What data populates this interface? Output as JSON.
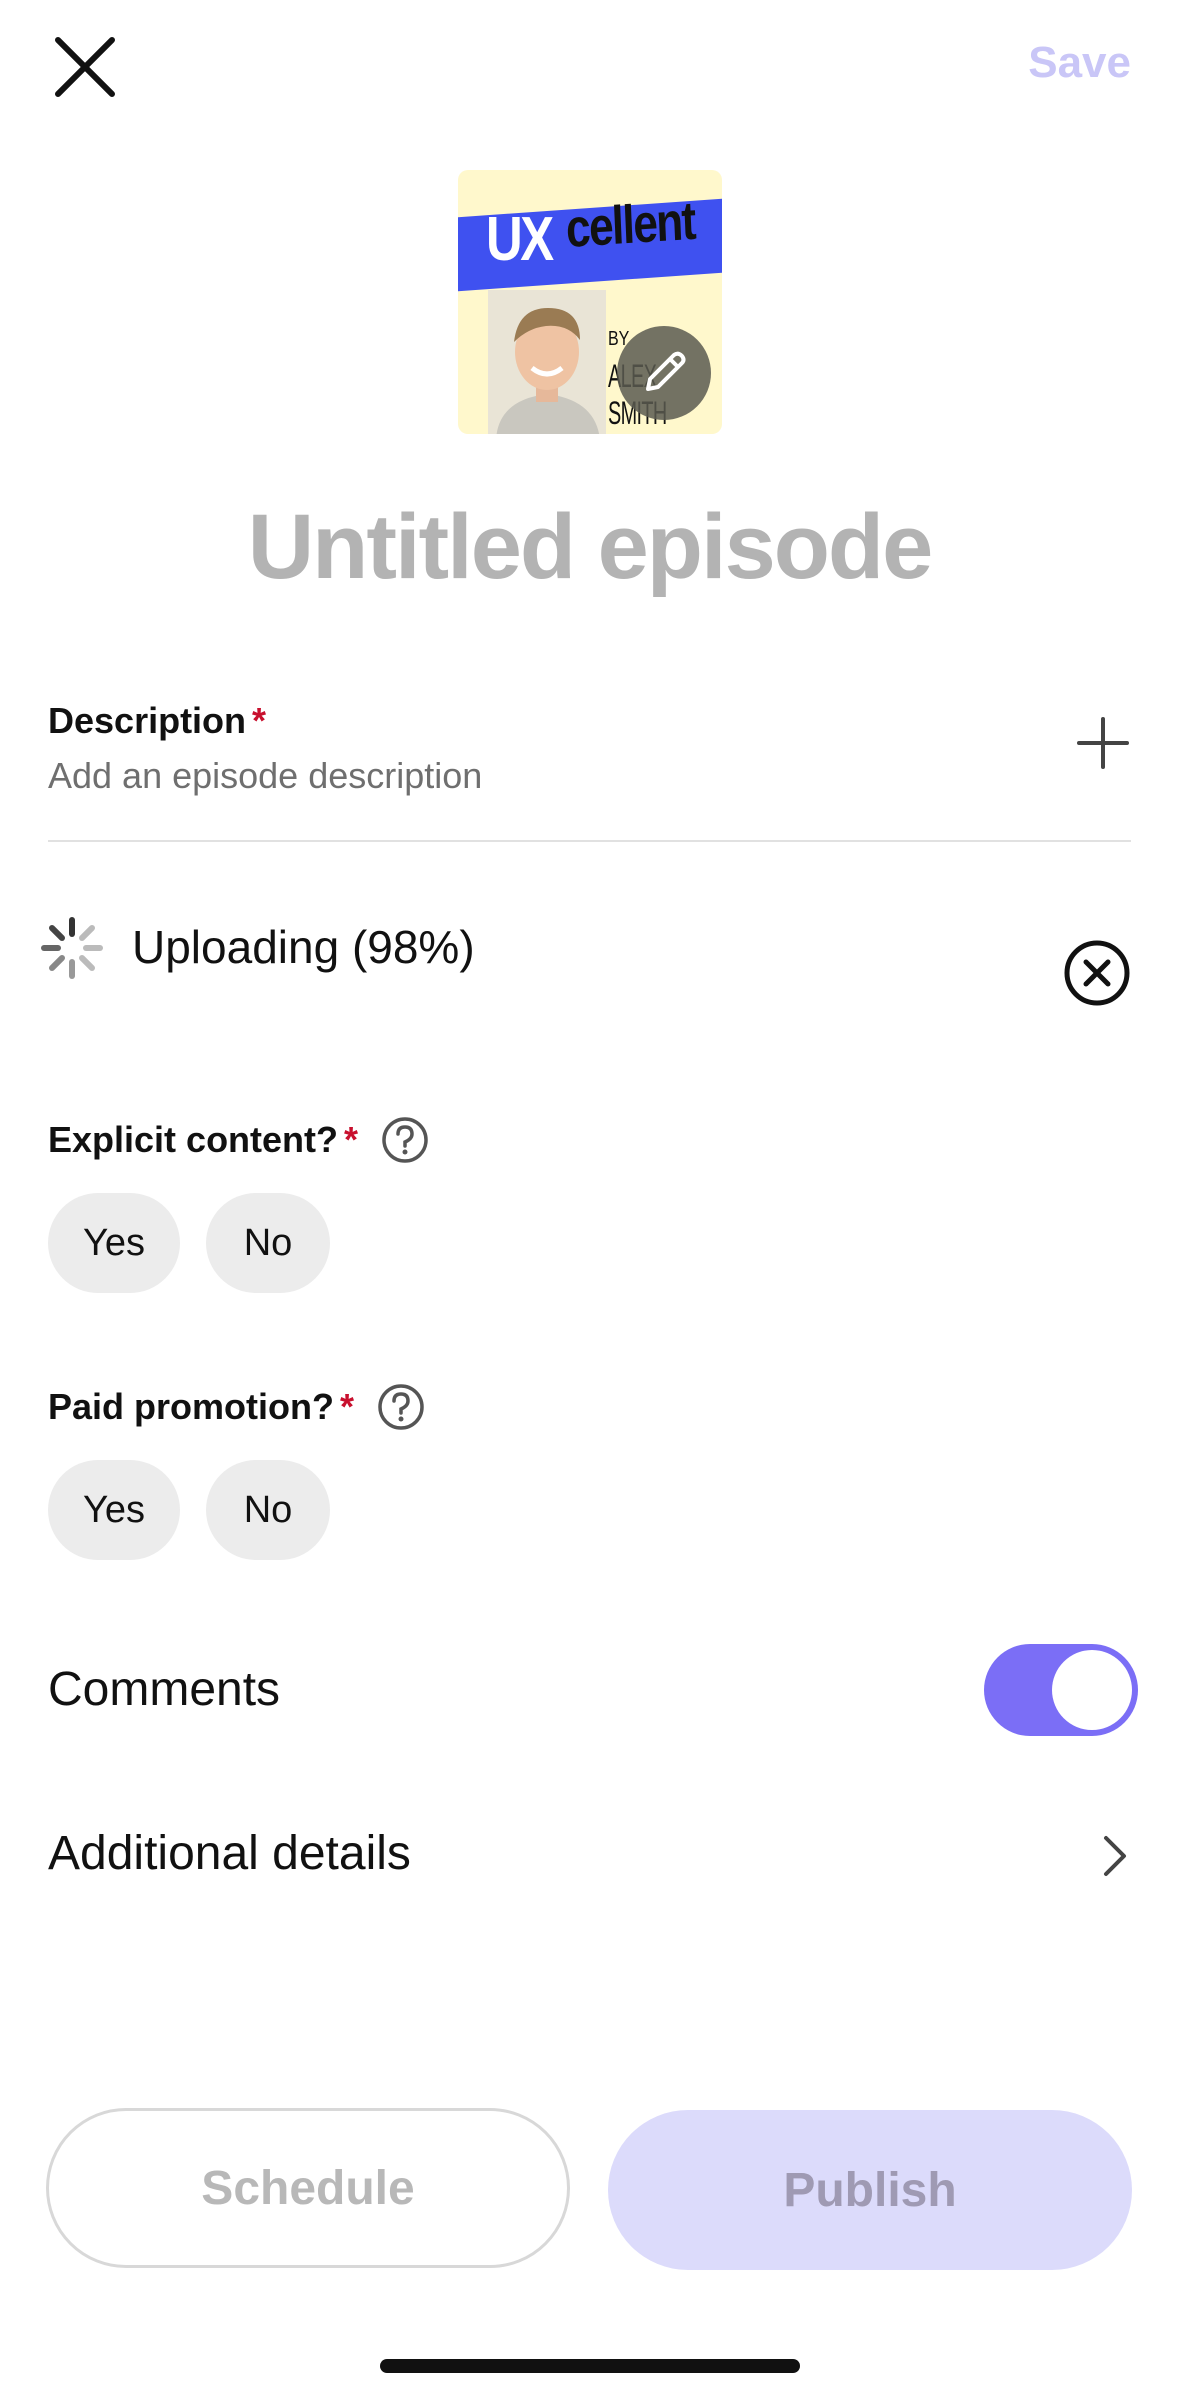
{
  "header": {
    "save_label": "Save",
    "close_icon": "close-icon"
  },
  "cover": {
    "title_part1": "UX",
    "title_part2": "cellent",
    "by": "BY",
    "author": "ALEX SMITH",
    "edit_icon": "pencil-icon"
  },
  "episode": {
    "title_placeholder": "Untitled episode"
  },
  "description": {
    "label": "Description",
    "required_mark": "*",
    "placeholder": "Add an episode description",
    "add_icon": "plus-icon"
  },
  "upload": {
    "status_text": "Uploading (98%)",
    "progress_percent": 98,
    "cancel_icon": "cancel-circle-icon"
  },
  "explicit": {
    "label": "Explicit content?",
    "required_mark": "*",
    "yes_label": "Yes",
    "no_label": "No"
  },
  "paid_promotion": {
    "label": "Paid promotion?",
    "required_mark": "*",
    "yes_label": "Yes",
    "no_label": "No"
  },
  "comments": {
    "label": "Comments",
    "enabled": true
  },
  "additional": {
    "label": "Additional details"
  },
  "footer": {
    "schedule_label": "Schedule",
    "publish_label": "Publish"
  },
  "colors": {
    "accent": "#7b6ef6",
    "accent_light": "#dcdbfb",
    "required": "#c8102e"
  }
}
